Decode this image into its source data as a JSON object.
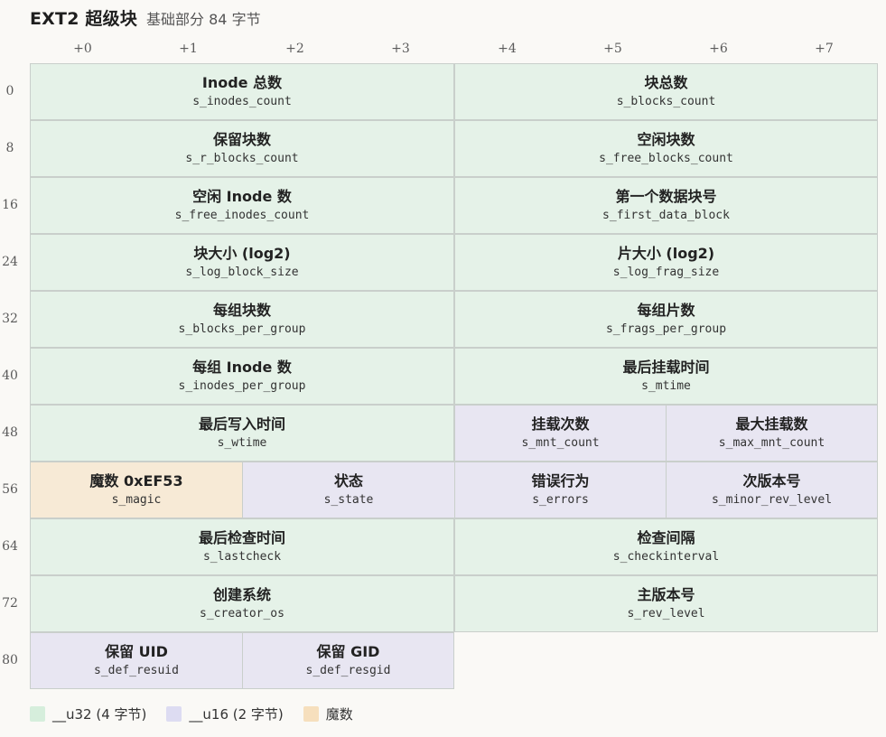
{
  "header": {
    "title": "EXT2 超级块",
    "subtitle": "基础部分 84 字节"
  },
  "columns": [
    "+0",
    "+1",
    "+2",
    "+3",
    "+4",
    "+5",
    "+6",
    "+7"
  ],
  "rows": [
    "0",
    "8",
    "16",
    "24",
    "32",
    "40",
    "48",
    "56",
    "64",
    "72",
    "80"
  ],
  "fields": [
    {
      "label": "Inode 总数",
      "field": "s_inodes_count",
      "type": "u32"
    },
    {
      "label": "块总数",
      "field": "s_blocks_count",
      "type": "u32"
    },
    {
      "label": "保留块数",
      "field": "s_r_blocks_count",
      "type": "u32"
    },
    {
      "label": "空闲块数",
      "field": "s_free_blocks_count",
      "type": "u32"
    },
    {
      "label": "空闲 Inode 数",
      "field": "s_free_inodes_count",
      "type": "u32"
    },
    {
      "label": "第一个数据块号",
      "field": "s_first_data_block",
      "type": "u32"
    },
    {
      "label": "块大小 (log2)",
      "field": "s_log_block_size",
      "type": "u32"
    },
    {
      "label": "片大小 (log2)",
      "field": "s_log_frag_size",
      "type": "u32"
    },
    {
      "label": "每组块数",
      "field": "s_blocks_per_group",
      "type": "u32"
    },
    {
      "label": "每组片数",
      "field": "s_frags_per_group",
      "type": "u32"
    },
    {
      "label": "每组 Inode 数",
      "field": "s_inodes_per_group",
      "type": "u32"
    },
    {
      "label": "最后挂载时间",
      "field": "s_mtime",
      "type": "u32"
    },
    {
      "label": "最后写入时间",
      "field": "s_wtime",
      "type": "u32"
    },
    {
      "label": "挂载次数",
      "field": "s_mnt_count",
      "type": "u16"
    },
    {
      "label": "最大挂载数",
      "field": "s_max_mnt_count",
      "type": "u16"
    },
    {
      "label": "魔数 0xEF53",
      "field": "s_magic",
      "type": "magic"
    },
    {
      "label": "状态",
      "field": "s_state",
      "type": "u16"
    },
    {
      "label": "错误行为",
      "field": "s_errors",
      "type": "u16"
    },
    {
      "label": "次版本号",
      "field": "s_minor_rev_level",
      "type": "u16"
    },
    {
      "label": "最后检查时间",
      "field": "s_lastcheck",
      "type": "u32"
    },
    {
      "label": "检查间隔",
      "field": "s_checkinterval",
      "type": "u32"
    },
    {
      "label": "创建系统",
      "field": "s_creator_os",
      "type": "u32"
    },
    {
      "label": "主版本号",
      "field": "s_rev_level",
      "type": "u32"
    },
    {
      "label": "保留 UID",
      "field": "s_def_resuid",
      "type": "u16"
    },
    {
      "label": "保留 GID",
      "field": "s_def_resgid",
      "type": "u16"
    }
  ],
  "legend": [
    {
      "label": "__u32 (4 字节)",
      "color": "#d6eedc"
    },
    {
      "label": "__u16 (2 字节)",
      "color": "#dddcf2"
    },
    {
      "label": "魔数",
      "color": "#f6dfbd"
    }
  ],
  "colors": {
    "u32": "#e5f2e8",
    "u16": "#e8e6f2",
    "magic": "#f7ead6"
  }
}
